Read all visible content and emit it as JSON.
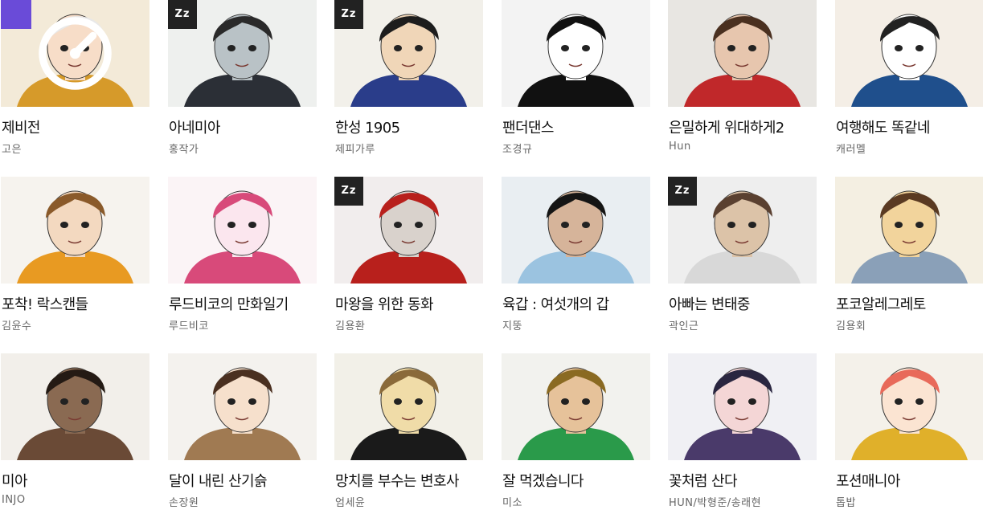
{
  "comics": [
    {
      "title": "제비전",
      "author": "고은",
      "badge": "timer",
      "bg": "#f3ead8",
      "hair": "#e8e8e8",
      "skin": "#f7ddc8",
      "accent": "#d69a2a"
    },
    {
      "title": "아네미아",
      "author": "홍작가",
      "badge": "zz",
      "bg": "#eef0ee",
      "hair": "#2a2a2a",
      "skin": "#b9c2c6",
      "accent": "#2b2f36"
    },
    {
      "title": "한성 1905",
      "author": "제피가루",
      "badge": "zz",
      "bg": "#f2f0ea",
      "hair": "#1d1d1d",
      "skin": "#f0d6b8",
      "accent": "#2a3d8a"
    },
    {
      "title": "팬더댄스",
      "author": "조경규",
      "badge": "none",
      "bg": "#f3f3f3",
      "hair": "#111111",
      "skin": "#ffffff",
      "accent": "#111111"
    },
    {
      "title": "은밀하게 위대하게2",
      "author": "Hun",
      "badge": "none",
      "bg": "#e8e6e2",
      "hair": "#4a3020",
      "skin": "#e7c6ae",
      "accent": "#c0282a"
    },
    {
      "title": "여행해도 똑같네",
      "author": "캐러멜",
      "badge": "none",
      "bg": "#f4eee6",
      "hair": "#222222",
      "skin": "#ffffff",
      "accent": "#1f4f8c"
    },
    {
      "title": "포착! 락스캔들",
      "author": "김윤수",
      "badge": "none",
      "bg": "#f6f3ee",
      "hair": "#8a5a2a",
      "skin": "#f3d9c0",
      "accent": "#e89a22"
    },
    {
      "title": "루드비코의 만화일기",
      "author": "루드비코",
      "badge": "none",
      "bg": "#fbf4f6",
      "hair": "#d84a7a",
      "skin": "#fbe6ee",
      "accent": "#d84a7a"
    },
    {
      "title": "마왕을 위한 동화",
      "author": "김용환",
      "badge": "zz",
      "bg": "#f1eded",
      "hair": "#b8201c",
      "skin": "#d9d2cc",
      "accent": "#b8201c"
    },
    {
      "title": "육갑 : 여섯개의 갑",
      "author": "지뚱",
      "badge": "none",
      "bg": "#e9eef2",
      "hair": "#151515",
      "skin": "#d6b49a",
      "accent": "#9bc3e0"
    },
    {
      "title": "아빠는 변태중",
      "author": "곽인근",
      "badge": "zz",
      "bg": "#eeeeee",
      "hair": "#5a4030",
      "skin": "#dcc3a8",
      "accent": "#d8d8d8"
    },
    {
      "title": "포코알레그레토",
      "author": "김용회",
      "badge": "none",
      "bg": "#f4efe2",
      "hair": "#5a3a22",
      "skin": "#f2d49c",
      "accent": "#8aa0b8"
    },
    {
      "title": "미아",
      "author": "INJO",
      "badge": "none",
      "bg": "#f2efea",
      "hair": "#241a14",
      "skin": "#8a6a52",
      "accent": "#6a4a36"
    },
    {
      "title": "달이 내린 산기슭",
      "author": "손장원",
      "badge": "none",
      "bg": "#f4f2ee",
      "hair": "#4a3020",
      "skin": "#f6e0cc",
      "accent": "#a07a52"
    },
    {
      "title": "망치를 부수는 변호사",
      "author": "엄세윤",
      "badge": "none",
      "bg": "#f2f0e8",
      "hair": "#8a6a3a",
      "skin": "#f0dca8",
      "accent": "#1a1a1a"
    },
    {
      "title": "잘 먹겠습니다",
      "author": "미소",
      "badge": "none",
      "bg": "#f2f2ee",
      "hair": "#8a6a22",
      "skin": "#e6c29a",
      "accent": "#2a9a4a"
    },
    {
      "title": "꽃처럼 산다",
      "author": "HUN/박형준/송래현",
      "badge": "none",
      "bg": "#f0f0f4",
      "hair": "#2a2640",
      "skin": "#f4d6d6",
      "accent": "#4a3a6a"
    },
    {
      "title": "포션매니아",
      "author": "톱밥",
      "badge": "none",
      "bg": "#f4f1ea",
      "hair": "#e86a5a",
      "skin": "#fbe4d2",
      "accent": "#e0b02a"
    }
  ],
  "badges": {
    "zz_label": "Zz"
  },
  "colors": {
    "timer_badge": "#6a4bd8",
    "zz_badge": "#222222",
    "title": "#111111",
    "author": "#666666"
  }
}
